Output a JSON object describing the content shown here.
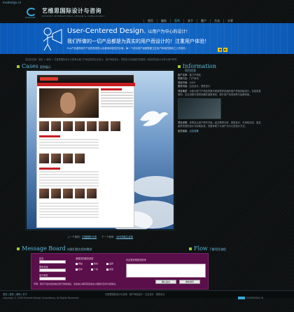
{
  "header": {
    "url": "evsdesign.cn",
    "logo_cn": "艺维思国际设计与咨询",
    "logo_mark_sub": "EVERSEE",
    "logo_en": "EVERSEE INTERNATIONAL DESIGN & CONSULTANCY"
  },
  "nav": [
    "首页",
    "服务",
    "案例",
    "关于",
    "客户",
    "方法",
    "分享"
  ],
  "banner": {
    "title_en": "User-Centered Design",
    "title_cn": "，以用户为中心的设计！",
    "line2": "我们所做的一切产品都是为真实的用户而设计的！注重用户体验！",
    "line3": "Evs产品重视用户产品的具现性以及使用体验性的价值，每一个成功的产品都是建立在用户体验的基础之上完成的。",
    "arrow_prev": "◀",
    "arrow_next": "▶"
  },
  "breadcrumb": "您当前位置：首页 > 案例 > 艺维思国际设计与咨询为某门户网站提供交互设计，用户体验设计，视觉设计及前端开发服务 | 网站项目设计分析与用户研究",
  "cases": {
    "title": "Cases",
    "subtitle": "案例展示",
    "prev_label": "上一个案例：",
    "prev_link": "中国国际马桥",
    "next_label": "下一个案例：",
    "next_link": "365同城生活馆"
  },
  "info": {
    "title": "Information",
    "subtitle": "项目信息",
    "rows": [
      {
        "label": "客户名称：",
        "value": "某门户网站"
      },
      {
        "label": "所属行业：",
        "value": "门户资讯"
      },
      {
        "label": "项目时间：",
        "value": "2009"
      },
      {
        "label": "服务内容：",
        "value": "交互设计，视觉设计"
      },
      {
        "label": "项目概述：",
        "value": "为某大型门户网站的娱乐频道提供全面的用户体验改版设计，包括信息架构、交互流程与视觉风格的重新规划，提升用户浏览效率与品牌形象。"
      },
      {
        "label": "项目说明：",
        "value": "该项目从用户研究开始，经过需求分析、原型设计、可用性测试，直至最终的视觉设计与前端实现，完整体现了以用户为中心的设计方法。"
      },
      {
        "label": "相关链接：",
        "value": "点击查看"
      }
    ]
  },
  "message": {
    "title": "Message Board",
    "subtitle": "向我们提交您的需求",
    "name_label": "姓名",
    "company_label": "联系电话",
    "email_label": "电子邮件",
    "needs_label": "需要您的服务类型",
    "options": [
      "网站",
      "移动",
      "品牌",
      "软件",
      "广告",
      "其他"
    ],
    "content_label": "在这里说明您的需求",
    "submit": "确认提交",
    "reset": "重新填写",
    "note": "声明：我们不会将您的信息用于其他用途，请您放心填写真实信息以便我们及时与您联系。"
  },
  "flow": {
    "title": "Flow",
    "link": "了解项目流程"
  },
  "footer": {
    "links": "首页 | 服务 | 案例 | 关于",
    "copyright": "Copyright © 2009 Eversee Design Consultancy. All Rights Reserved.",
    "middle": "艺维思国际设计与咨询 · 用户体验设计 · 交互设计 · 视觉设计",
    "brand": "EVSDESIGN.CN"
  }
}
